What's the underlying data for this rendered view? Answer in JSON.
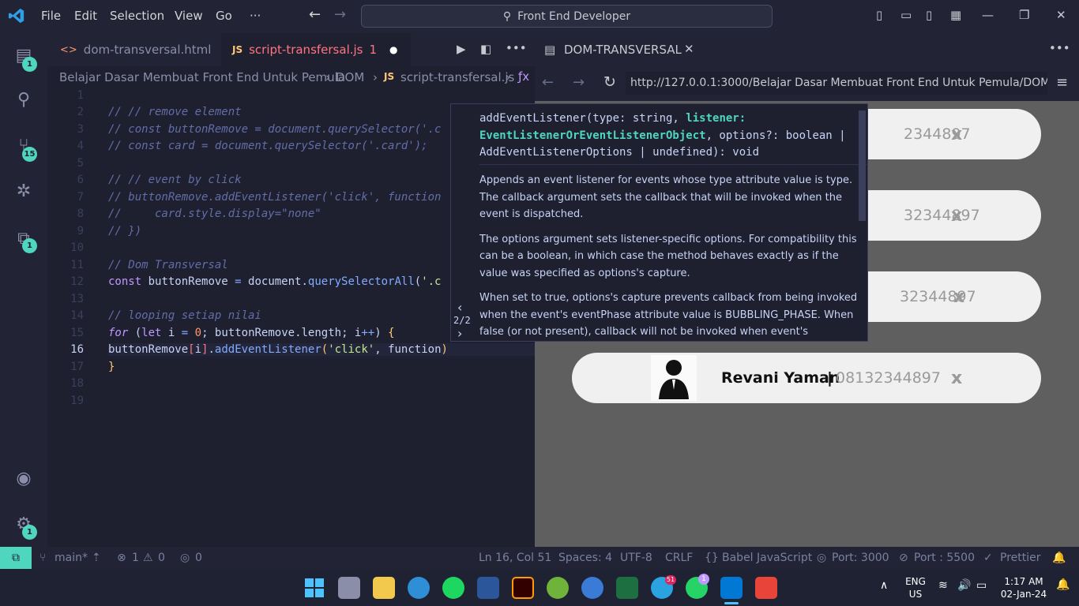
{
  "menu": [
    "File",
    "Edit",
    "Selection",
    "View",
    "Go",
    "···"
  ],
  "command_center": "Front End Developer",
  "activity_badges": {
    "explorer": "1",
    "scm": "15",
    "extensions": "1",
    "settings": "1"
  },
  "tabs": [
    {
      "label": "dom-transversal.html",
      "icon": "<>"
    },
    {
      "label": "script-transfersal.js",
      "icon": "JS",
      "badge": "1"
    }
  ],
  "breadcrumb": [
    "Belajar Dasar Membuat Front End Untuk Pemula",
    "DOM",
    "script-transfersal.js"
  ],
  "breadcrumb_js": "JS",
  "code_lines": [
    "1",
    "2",
    "3",
    "4",
    "5",
    "6",
    "7",
    "8",
    "9",
    "10",
    "11",
    "12",
    "13",
    "14",
    "15",
    "16",
    "17",
    "18",
    "19"
  ],
  "hover": {
    "counter": "2/2",
    "sig_1": "addEventListener(type: string, ",
    "sig_param": "listener: EventListenerOrEventListenerObject",
    "sig_2": ", options?: boolean | AddEventListenerOptions | undefined): void",
    "doc_1": "Appends an event listener for events whose type attribute value is type. The callback argument sets the callback that will be invoked when the event is dispatched.",
    "doc_2": "The options argument sets listener-specific options. For compatibility this can be a boolean, in which case the method behaves exactly as if the value was specified as options's capture.",
    "doc_3": "When set to true, options's capture prevents callback from being invoked when the event's eventPhase attribute value is BUBBLING_PHASE. When false (or not present), callback will not be invoked when event's eventPhase"
  },
  "browser_tab": "DOM-TRANSVERSAL",
  "url": "http://127.0.0.1:3000/Belajar Dasar Membuat Front End Untuk Pemula/DOM",
  "cards": [
    {
      "name": "",
      "phone": "2344897",
      "x": "x"
    },
    {
      "name": "",
      "phone": "32344897",
      "x": "x"
    },
    {
      "name": "",
      "phone": "32344897",
      "x": "x"
    },
    {
      "name": "Revani Yaman",
      "sep": "|",
      "phone": "08132344897",
      "x": "x"
    }
  ],
  "status": {
    "branch": "main*",
    "errors": "1",
    "warnings": "0",
    "ports": "0",
    "position": "Ln 16, Col 51",
    "spaces": "Spaces: 4",
    "encoding": "UTF-8",
    "eol": "CRLF",
    "language": "Babel JavaScript",
    "port": "Port: 3000",
    "port2": "Port : 5500",
    "prettier": "Prettier"
  },
  "taskbar": {
    "lang1": "ENG",
    "lang2": "US",
    "time": "1:17 AM",
    "date": "02-Jan-24",
    "telegram_badge": "51",
    "whatsapp_badge": "1"
  }
}
